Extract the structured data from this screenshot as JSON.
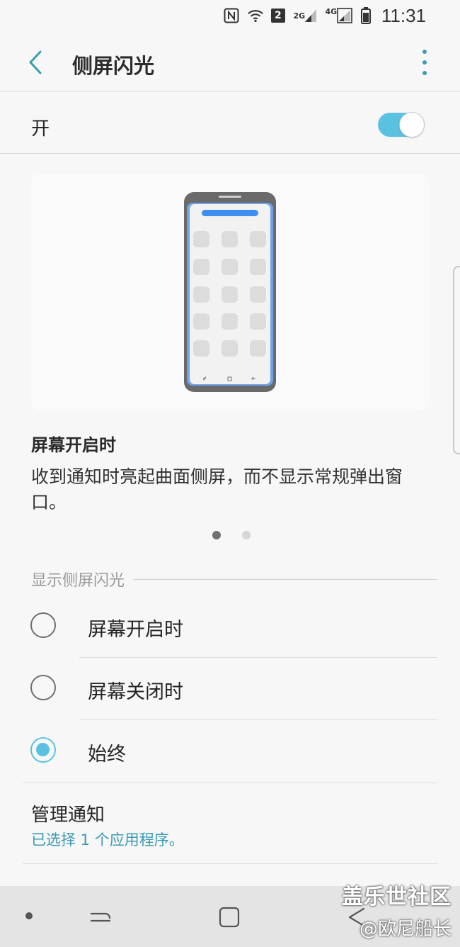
{
  "status_bar": {
    "time": "11:31",
    "sim_badge": "2",
    "net_2g": "2G",
    "net_4g": "4G"
  },
  "app_bar": {
    "title": "侧屏闪光",
    "back_icon": "chevron-left-icon",
    "more_icon": "more-vert-icon"
  },
  "master_switch": {
    "label": "开",
    "on": true,
    "accent": "#5ac2e0"
  },
  "description": {
    "title": "屏幕开启时",
    "text": "收到通知时亮起曲面侧屏，而不显示常规弹出窗口。",
    "page": 1,
    "pages": 2
  },
  "display_section": {
    "header": "显示侧屏闪光",
    "options": [
      {
        "label": "屏幕开启时",
        "checked": false
      },
      {
        "label": "屏幕关闭时",
        "checked": false
      },
      {
        "label": "始终",
        "checked": true
      }
    ]
  },
  "manage": {
    "title": "管理通知",
    "subtitle": "已选择 1 个应用程序。"
  },
  "watermark": {
    "line1": "盖乐世社区",
    "line2": "@欧尼船长"
  },
  "colors": {
    "accent": "#5ac2e0",
    "link": "#3b9ab5",
    "background": "#f7f7f7"
  }
}
